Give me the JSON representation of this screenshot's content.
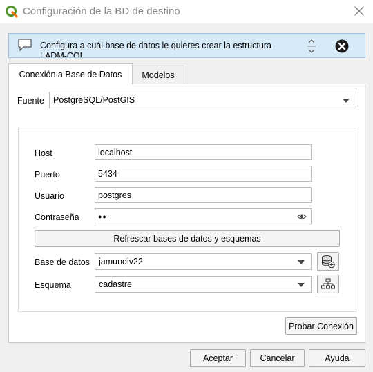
{
  "window": {
    "title": "Configuración de la BD de destino"
  },
  "message": {
    "text": "Configura a cuál base de datos le quieres crear la estructura LADM-COL"
  },
  "tabs": [
    {
      "label": "Conexión a Base de Datos",
      "active": true
    },
    {
      "label": "Modelos",
      "active": false
    }
  ],
  "source": {
    "label": "Fuente",
    "value": "PostgreSQL/PostGIS"
  },
  "connection": {
    "host_label": "Host",
    "host_value": "localhost",
    "port_label": "Puerto",
    "port_value": "5434",
    "user_label": "Usuario",
    "user_value": "postgres",
    "password_label": "Contraseña",
    "password_value": "●●",
    "refresh_label": "Refrescar bases de datos y esquemas",
    "database_label": "Base de datos",
    "database_value": "jamundiv22",
    "schema_label": "Esquema",
    "schema_value": "cadastre",
    "test_label": "Probar Conexión"
  },
  "footer": {
    "accept_label": "Aceptar",
    "cancel_label": "Cancelar",
    "help_label": "Ayuda"
  },
  "colors": {
    "message_bg": "#d7eaf7",
    "qgis_green": "#589632"
  },
  "icons": [
    "qgis-logo-icon",
    "close-icon",
    "message-icon",
    "scroll-arrows-icon",
    "dismiss-icon",
    "eye-icon",
    "add-database-icon",
    "schema-tree-icon",
    "dropdown-arrow-icon"
  ]
}
